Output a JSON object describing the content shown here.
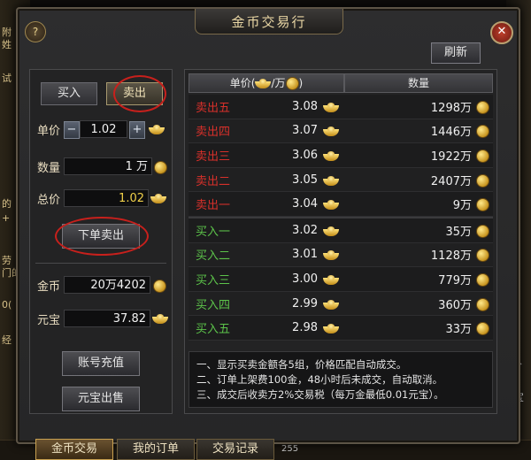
{
  "window": {
    "title": "金币交易行",
    "help_label": "?",
    "close_label": "✕",
    "refresh_label": "刷新"
  },
  "trade_tabs": {
    "buy_label": "买入",
    "sell_label": "卖出",
    "active": "sell"
  },
  "order_form": {
    "unit_price_label": "单价",
    "unit_price_value": "1.02",
    "minus_label": "−",
    "plus_label": "+",
    "quantity_label": "数量",
    "quantity_value": "1 万",
    "total_label": "总价",
    "total_value": "1.02",
    "submit_label": "下单卖出"
  },
  "balance": {
    "gold_label": "金币",
    "gold_value": "20万4202",
    "ingot_label": "元宝",
    "ingot_value": "37.82"
  },
  "actions": {
    "recharge_label": "账号充值",
    "sell_ingot_label": "元宝出售"
  },
  "table": {
    "price_header": "单价(",
    "price_header_unit": "/万",
    "price_header_end": ")",
    "qty_header": "数量",
    "sell_orders": [
      {
        "name": "卖出五",
        "price": "3.08",
        "qty": "1298万"
      },
      {
        "name": "卖出四",
        "price": "3.07",
        "qty": "1446万"
      },
      {
        "name": "卖出三",
        "price": "3.06",
        "qty": "1922万"
      },
      {
        "name": "卖出二",
        "price": "3.05",
        "qty": "2407万"
      },
      {
        "name": "卖出一",
        "price": "3.04",
        "qty": "9万"
      }
    ],
    "buy_orders": [
      {
        "name": "买入一",
        "price": "3.02",
        "qty": "35万"
      },
      {
        "name": "买入二",
        "price": "3.01",
        "qty": "1128万"
      },
      {
        "name": "买入三",
        "price": "3.00",
        "qty": "779万"
      },
      {
        "name": "买入四",
        "price": "2.99",
        "qty": "360万"
      },
      {
        "name": "买入五",
        "price": "2.98",
        "qty": "33万"
      }
    ]
  },
  "notes": [
    "一、显示买卖金额各5组，价格匹配自动成交。",
    "二、订单上架费100金，48小时后未成交，自动取消。",
    "三、成交后收卖方2%交易税（每万金最低0.01元宝）。"
  ],
  "bottom_tabs": {
    "gold_trade": "金币交易",
    "my_orders": "我的订单",
    "trade_log": "交易记录"
  },
  "background": {
    "left_fragments": [
      "附",
      "姓",
      "试",
      "的",
      "+",
      "劳",
      "门的",
      "0(",
      "经"
    ],
    "right_fragments": [
      "分",
      "宝"
    ],
    "bottom_number": "255"
  }
}
